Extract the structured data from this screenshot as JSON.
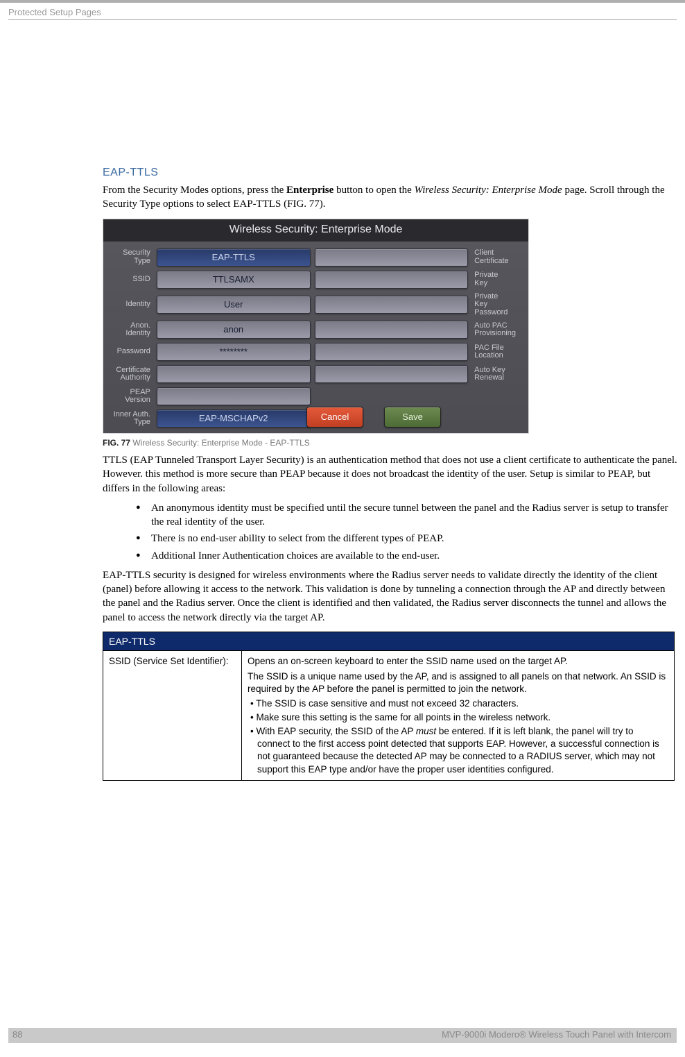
{
  "header": {
    "text": "Protected Setup Pages"
  },
  "section_title": "EAP-TTLS",
  "intro": {
    "pre": "From the Security Modes options, press the ",
    "bold": "Enterprise",
    "mid": " button to open the ",
    "italic": "Wireless Security: Enterprise Mode",
    "post": " page. Scroll through the Security Type options to select EAP-TTLS (FIG. 77)."
  },
  "screenshot": {
    "title": "Wireless Security: Enterprise Mode",
    "left_labels": {
      "security_type": "Security\nType",
      "ssid": "SSID",
      "identity": "Identity",
      "anon_identity": "Anon.\nIdentity",
      "password": "Password",
      "cert_auth": "Certificate\nAuthority",
      "peap_version": "PEAP\nVersion",
      "inner_auth": "Inner Auth.\nType"
    },
    "left_values": {
      "security_type": "EAP-TTLS",
      "ssid": "TTLSAMX",
      "identity": "User",
      "anon_identity": "anon",
      "password": "********",
      "cert_auth": "",
      "peap_version": "",
      "inner_auth": "EAP-MSCHAPv2"
    },
    "right_labels": {
      "client_cert": "Client\nCertificate",
      "private_key": "Private\nKey",
      "private_key_pw": "Private\nKey\nPassword",
      "auto_pac": "Auto PAC\nProvisioning",
      "pac_file": "PAC File\nLocation",
      "auto_key": "Auto Key\nRenewal"
    },
    "buttons": {
      "cancel": "Cancel",
      "save": "Save"
    }
  },
  "fig_caption": {
    "bold": "FIG. 77",
    "text": "  Wireless Security: Enterprise Mode - EAP-TTLS"
  },
  "para1": "TTLS (EAP Tunneled Transport Layer Security) is an authentication method that does not use a client certificate to authenticate the panel. However. this method is more secure than PEAP because it does not broadcast the identity of the user. Setup is similar to PEAP, but differs in the following areas:",
  "bullets": [
    "An anonymous identity must be specified until the secure tunnel between the panel and the Radius server is setup to transfer the real identity of the user.",
    "There is no end-user ability to select from the different types of PEAP.",
    "Additional Inner Authentication choices are available to the end-user."
  ],
  "para2": "EAP-TTLS security is designed for wireless environments where the Radius server needs to validate directly the identity of the client (panel) before allowing it access to the network. This validation is done by tunneling a connection through the AP and directly between the panel and the Radius server. Once the client is identified and then validated, the Radius server disconnects the tunnel and allows the panel to access the network directly via the target AP.",
  "table": {
    "header": "EAP-TTLS",
    "row1_col1": "SSID (Service Set Identifier):",
    "row1_col2": {
      "p1": "Opens an on-screen keyboard to enter the SSID name used on the target AP.",
      "p2": "The SSID is a unique name used by the AP, and is assigned to all panels on that network. An SSID is required by the AP before the panel is permitted to join the network.",
      "b1": "• The SSID is case sensitive and must not exceed 32 characters.",
      "b2": "• Make sure this setting is the same for all points in the wireless network.",
      "b3a": "• With EAP security, the SSID of the AP ",
      "b3_italic": "must",
      "b3b": " be entered. If it is left blank, the panel will try to connect to the first access point detected that supports EAP. However, a successful connection is not guaranteed because the detected AP may be connected to a RADIUS server, which may not support this EAP type and/or have the proper user identities configured."
    }
  },
  "footer": {
    "page": "88",
    "title": "MVP-9000i Modero® Wireless Touch Panel with Intercom"
  }
}
